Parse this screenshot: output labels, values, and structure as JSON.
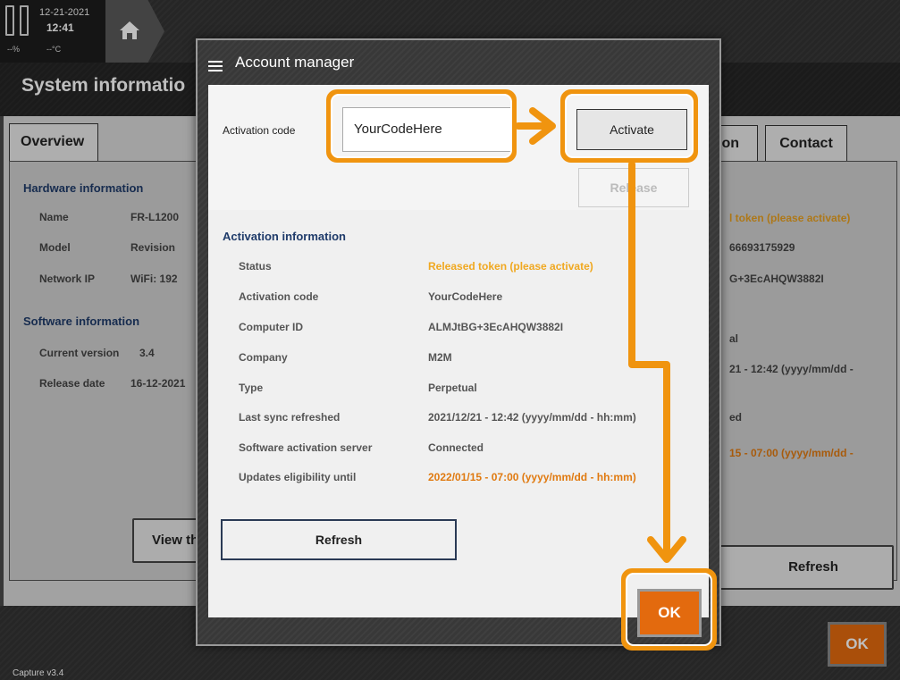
{
  "status": {
    "date": "12-21-2021",
    "time": "12:41",
    "humidity": "--%",
    "temperature": "--°C"
  },
  "page": {
    "title": "System informatio",
    "tabs": [
      "Overview",
      "ion",
      "Contact"
    ]
  },
  "background": {
    "hardware_title": "Hardware information",
    "hardware": [
      {
        "label": "Name",
        "value": "FR-L1200"
      },
      {
        "label": "Model",
        "value": "Revision"
      },
      {
        "label": "Network IP",
        "value": "WiFi: 192"
      }
    ],
    "software_title": "Software information",
    "software": [
      {
        "label": "Current version",
        "value": "3.4"
      },
      {
        "label": "Release date",
        "value": "16-12-2021"
      }
    ],
    "right_values": [
      "l token (please activate)",
      "66693175929",
      "G+3EcAHQW3882I",
      "al",
      "21 - 12:42 (yyyy/mm/dd -",
      "ed",
      "15 - 07:00 (yyyy/mm/dd -"
    ],
    "view_button": "View th",
    "refresh_button": "Refresh",
    "ok_button": "OK",
    "version": "Capture v3.4"
  },
  "dialog": {
    "title": "Account manager",
    "activation_code_label": "Activation code",
    "activation_code_value": "YourCodeHere",
    "activate_button": "Activate",
    "release_button": "Release",
    "section_title": "Activation information",
    "info": [
      {
        "label": "Status",
        "value": "Released token (please activate)",
        "color": "#f0a820"
      },
      {
        "label": "Activation code",
        "value": "YourCodeHere",
        "color": "#555555"
      },
      {
        "label": "Computer ID",
        "value": "ALMJtBG+3EcAHQW3882I",
        "color": "#555555"
      },
      {
        "label": "Company",
        "value": "M2M",
        "color": "#555555"
      },
      {
        "label": "Type",
        "value": "Perpetual",
        "color": "#555555"
      },
      {
        "label": "Last sync refreshed",
        "value": "2021/12/21 - 12:42 (yyyy/mm/dd - hh:mm)",
        "color": "#555555"
      },
      {
        "label": "Software activation server",
        "value": "Connected",
        "color": "#555555"
      },
      {
        "label": "Updates eligibility until",
        "value": "2022/01/15 - 07:00 (yyyy/mm/dd - hh:mm)",
        "color": "#e07a10"
      }
    ],
    "refresh_button": "Refresh",
    "ok_button": "OK"
  },
  "colors": {
    "accent_orange": "#e36a0e",
    "highlight": "#f0940f",
    "section_blue": "#1f3b6a"
  }
}
